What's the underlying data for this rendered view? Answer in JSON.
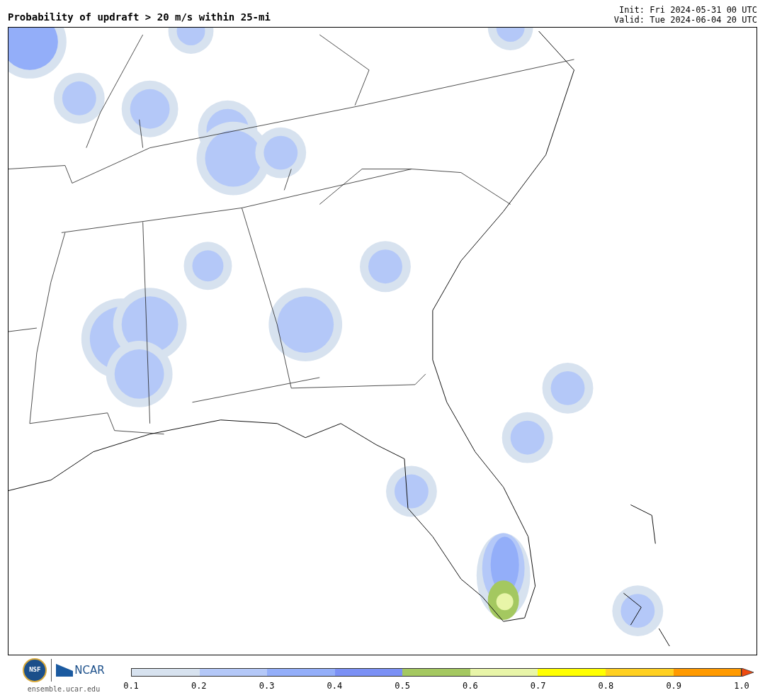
{
  "title": "Probability of updraft > 20 m/s within 25-mi",
  "init": "Init: Fri 2024-05-31 00 UTC",
  "valid": "Valid: Tue 2024-06-04 20 UTC",
  "colorbar": {
    "bins": [
      {
        "color": "#d7e2ef"
      },
      {
        "color": "#b4c8f8"
      },
      {
        "color": "#93aef9"
      },
      {
        "color": "#7b90f5"
      },
      {
        "color": "#a4c860"
      },
      {
        "color": "#e8f5a8"
      },
      {
        "color": "#ffff00"
      },
      {
        "color": "#ffd020"
      },
      {
        "color": "#ff9a00"
      }
    ],
    "extend": {
      "color": "#ee4a10"
    },
    "ticks": [
      "0.1",
      "0.2",
      "0.3",
      "0.4",
      "0.5",
      "0.6",
      "0.7",
      "0.8",
      "0.9",
      "1.0"
    ]
  },
  "logos": {
    "nsf": "NSF",
    "ncar": "NCAR",
    "site": "ensemble.ucar.edu"
  }
}
